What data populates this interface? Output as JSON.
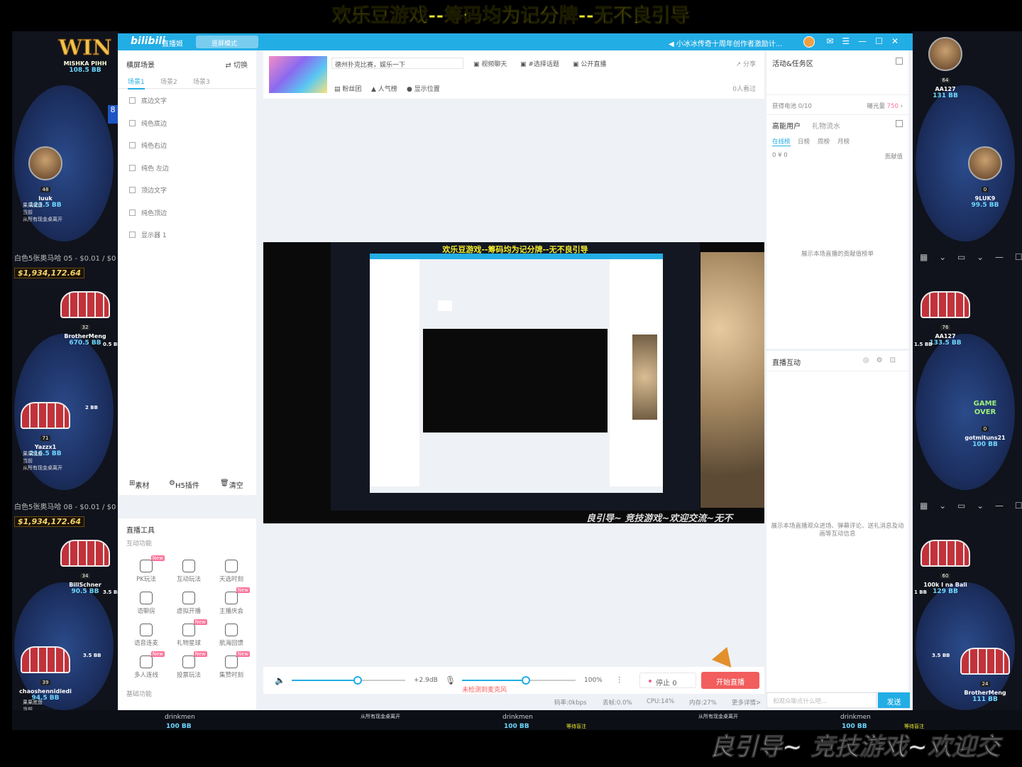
{
  "banner": {
    "top": "欢乐豆游戏--筹码均为记分牌--无不良引导",
    "bottom": "良引导~ 竞技游戏~欢迎交"
  },
  "background": {
    "left_win": {
      "logo": "WIN",
      "name": "MISHKA PIHH",
      "bb": "108.5 BB"
    },
    "left_seats": [
      {
        "name": "luuk",
        "bb": "123.5 BB",
        "badge": "48"
      },
      {
        "name": "BrotherMeng",
        "bb": "670.5 BB",
        "badge": "32"
      },
      {
        "name": "Yazzx1",
        "bb": "216.5 BB",
        "badge": "71"
      },
      {
        "name": "BillSchner",
        "bb": "90.5 BB",
        "badge": "34"
      },
      {
        "name": "chaoshennidiedi",
        "bb": "94.5 BB",
        "badge": "39"
      }
    ],
    "right_seats": [
      {
        "name": "AA127",
        "bb": "131 BB",
        "badge": "64"
      },
      {
        "name": "9LUK9",
        "bb": "99.5 BB",
        "badge": "0"
      },
      {
        "name": "AA127",
        "bb": "133.5 BB",
        "badge": "76"
      },
      {
        "name": "gotmituns21",
        "bb": "100 BB",
        "badge": "0"
      },
      {
        "name": "100k I na Bali",
        "bb": "129 BB",
        "badge": "60"
      },
      {
        "name": "BrotherMeng",
        "bb": "111 BB",
        "badge": "24"
      }
    ],
    "game_over": "GAME OVER",
    "table_title_1": "白色5张奥马哈 05 - $0.01 / $0",
    "table_title_2": "白色5张奥马哈 08 - $0.01 / $0",
    "jackpot": "$1,934,172.64",
    "left_small_bbs": [
      "0.5 BB",
      "2 BB",
      "3.5 BB",
      "3.5 BB"
    ],
    "right_small_bbs": [
      "1.5 BB",
      "1 BB",
      "3.5 BB"
    ],
    "left_side_counter": "8",
    "left_notes": [
      "果果底盘",
      "当前",
      "从所有现金桌离开"
    ],
    "bottom_names": [
      "drinkmen",
      "drinkmen",
      "drinkmen"
    ],
    "bottom_bbs": [
      "100 BB",
      "100 BB",
      "100 BB"
    ],
    "bottom_notes": [
      "从所有现金桌离开",
      "从所有现金桌离开"
    ],
    "bottom_waits": [
      "等待盲注",
      "等待盲注"
    ]
  },
  "app": {
    "logo": "bilibili",
    "app_name": "直播姬",
    "mode": "竖屏模式",
    "notice": "小冰冰传奇十周年创作者激励计...",
    "window_buttons": [
      "✉",
      "☰",
      "—",
      "☐",
      "✕"
    ],
    "scenes_header": "横屏场景",
    "switch_label": "切换",
    "scene_tabs": [
      "场景1",
      "场景2",
      "场景3"
    ],
    "sources": [
      "底边文字",
      "纯色底边",
      "纯色右边",
      "纯色 左边",
      "顶边文字",
      "纯色顶边",
      "显示器 1"
    ],
    "left_footer": {
      "material": "素材",
      "h5": "H5插件",
      "clear": "清空"
    },
    "tools": {
      "header": "直播工具",
      "section_interactive": "互动功能",
      "section_basic": "基础功能",
      "items": [
        {
          "label": "PK玩法",
          "new": "New"
        },
        {
          "label": "互动玩法",
          "new": ""
        },
        {
          "label": "天选时刻",
          "new": ""
        },
        {
          "label": "语聊房",
          "new": ""
        },
        {
          "label": "虚拟开播",
          "new": ""
        },
        {
          "label": "主播庆会",
          "new": "New"
        },
        {
          "label": "语音连麦",
          "new": ""
        },
        {
          "label": "礼物星球",
          "new": "New"
        },
        {
          "label": "航海回馈",
          "new": ""
        },
        {
          "label": "多人连线",
          "new": "New"
        },
        {
          "label": "投票玩法",
          "new": "New"
        },
        {
          "label": "集赞时刻",
          "new": "New"
        }
      ]
    },
    "room": {
      "title": "德州扑克比赛，娱乐一下",
      "actions": [
        "视频聊天",
        "#选择话题",
        "公开直播"
      ],
      "share": "分享",
      "actions2": [
        "粉丝团",
        "人气榜",
        "显示位置"
      ],
      "viewers": "0人看过"
    },
    "preview": {
      "inner_title": "欢乐豆游戏--筹码均为记分牌--无不良引导",
      "marquee": "良引导~ 竞技游戏~欢迎交流~无不"
    },
    "controls": {
      "db": "+2.9dB",
      "mic_percent": "100%",
      "mic_warning": "未检测到麦克风",
      "stop": "停止",
      "stop_counter": "0",
      "start_live": "开始直播",
      "speaker_volume": 0.58,
      "mic_volume": 0.56
    },
    "status": {
      "bitrate": "码率:0kbps",
      "drop": "丢帧:0.0%",
      "cpu": "CPU:14%",
      "mem": "内存:27%",
      "more": "更多详情>"
    },
    "right": {
      "activity_header": "活动&任务区",
      "battery": "获得电池",
      "battery_value": "0/10",
      "glow": "曝光量",
      "glow_value": "750",
      "tab_users": "高能用户",
      "tab_gifts": "礼物流水",
      "subtabs": [
        "在线榜",
        "日榜",
        "周榜",
        "月榜"
      ],
      "counts": "0  ¥ 0",
      "contrib": "贡献值",
      "empty": "展示本场直播的贡献值榜单",
      "interact_header": "直播互动",
      "interact_empty": "展示本场直播观众进场、弹幕评论、送礼消息及动画等互动信息",
      "chat_placeholder": "和观众聊点什么吧...",
      "send": "发送"
    }
  }
}
